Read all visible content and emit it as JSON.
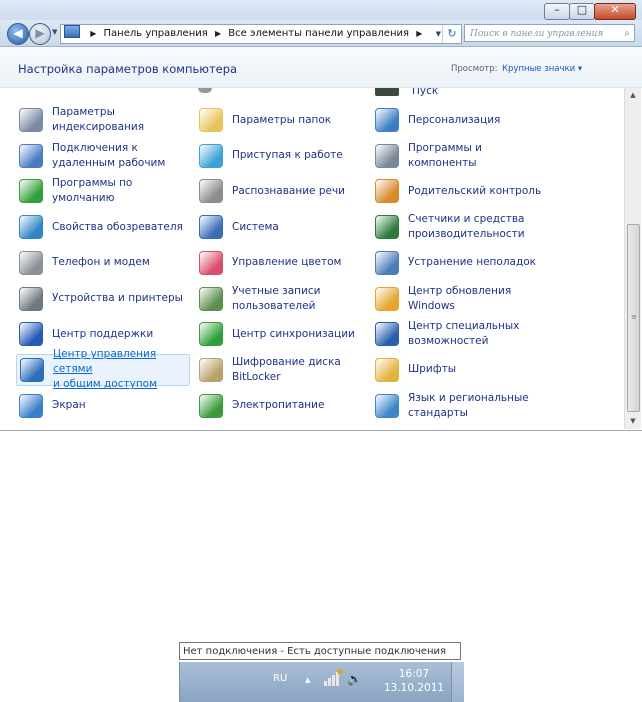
{
  "window": {
    "address": {
      "crumb1": "Панель управления",
      "crumb2": "Все элементы панели управления"
    },
    "search_placeholder": "Поиск в панели управления",
    "header_title": "Настройка параметров компьютера",
    "view_label": "Просмотр:",
    "view_value": "Крупные значки",
    "partial_item": "Пуск",
    "items": [
      {
        "label": "Параметры\nиндексирования",
        "icon": "indexing-icon",
        "color": "#7a8aa2"
      },
      {
        "label": "Параметры папок",
        "icon": "folder-options-icon",
        "color": "#e8c55a"
      },
      {
        "label": "Персонализация",
        "icon": "personalization-icon",
        "color": "#3d7fc7"
      },
      {
        "label": "Подключения к\nудаленным рабочим",
        "icon": "remote-connections-icon",
        "color": "#4a7cc2"
      },
      {
        "label": "Приступая к работе",
        "icon": "getting-started-icon",
        "color": "#3fa0d8"
      },
      {
        "label": "Программы и\nкомпоненты",
        "icon": "programs-icon",
        "color": "#7a8899"
      },
      {
        "label": "Программы по\nумолчанию",
        "icon": "default-programs-icon",
        "color": "#35a03b"
      },
      {
        "label": "Распознавание речи",
        "icon": "microphone-icon",
        "color": "#8c8c8c"
      },
      {
        "label": "Родительский контроль",
        "icon": "parental-control-icon",
        "color": "#d78a2a"
      },
      {
        "label": "Свойства обозревателя",
        "icon": "internet-options-icon",
        "color": "#2f86c7"
      },
      {
        "label": "Система",
        "icon": "system-icon",
        "color": "#3a6db5"
      },
      {
        "label": "Счетчики и средства\nпроизводительности",
        "icon": "performance-icon",
        "color": "#2d7a3a"
      },
      {
        "label": "Телефон и модем",
        "icon": "phone-modem-icon",
        "color": "#8a9096"
      },
      {
        "label": "Управление цветом",
        "icon": "color-management-icon",
        "color": "#d94f6a"
      },
      {
        "label": "Устранение неполадок",
        "icon": "troubleshooting-icon",
        "color": "#4b7db8"
      },
      {
        "label": "Устройства и принтеры",
        "icon": "devices-printers-icon",
        "color": "#6f7780"
      },
      {
        "label": "Учетные записи\nпользователей",
        "icon": "user-accounts-icon",
        "color": "#5c8f4f"
      },
      {
        "label": "Центр обновления\nWindows",
        "icon": "windows-update-icon",
        "color": "#e5a62b"
      },
      {
        "label": "Центр поддержки",
        "icon": "action-center-icon",
        "color": "#2659b8"
      },
      {
        "label": "Центр синхронизации",
        "icon": "sync-center-icon",
        "color": "#2fa03a"
      },
      {
        "label": "Центр специальных\nвозможностей",
        "icon": "ease-of-access-icon",
        "color": "#2a5fb0"
      },
      {
        "label": "Центр управления сетями\nи общим доступом",
        "icon": "network-center-icon",
        "color": "#2d6db8"
      },
      {
        "label": "Шифрование диска\nBitLocker",
        "icon": "bitlocker-icon",
        "color": "#b7a36a"
      },
      {
        "label": "Шрифты",
        "icon": "fonts-icon",
        "color": "#e2b33c"
      },
      {
        "label": "Экран",
        "icon": "display-icon",
        "color": "#3b7ec9"
      },
      {
        "label": "Электропитание",
        "icon": "power-options-icon",
        "color": "#3b9a3b"
      },
      {
        "label": "Язык и региональные\nстандарты",
        "icon": "region-language-icon",
        "color": "#3c86c9"
      }
    ],
    "selected_item": "Центр управления сетями\nи общим доступом"
  },
  "tray": {
    "tooltip": "Нет подключения - Есть доступные подключения",
    "language": "RU",
    "time": "16:07",
    "date": "13.10.2011"
  }
}
